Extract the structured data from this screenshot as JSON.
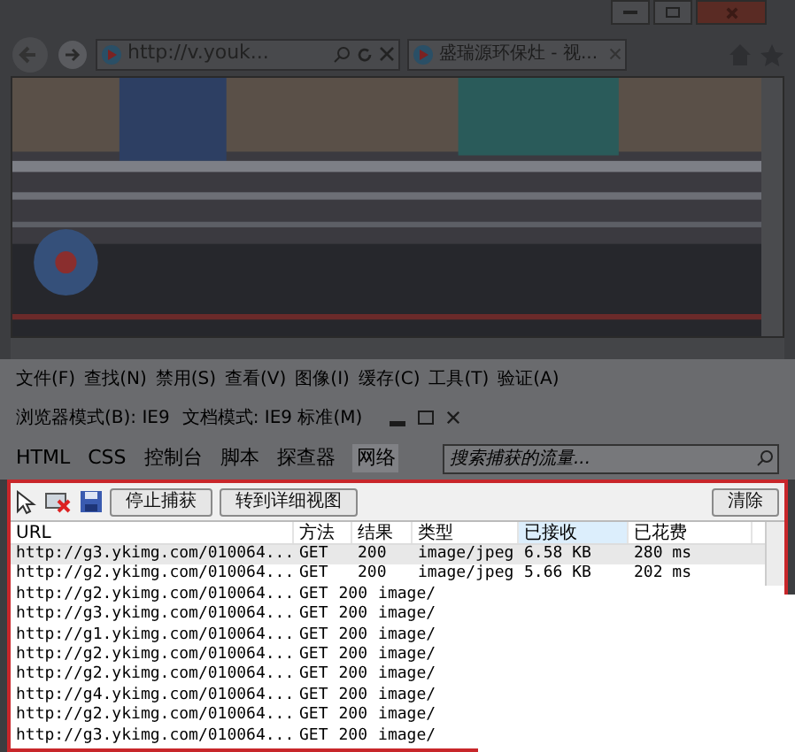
{
  "browser": {
    "address": "http://v.youk...",
    "tab_title": "盛瑞源环保灶 - 视..."
  },
  "devtools": {
    "menu": [
      "文件(F)",
      "查找(N)",
      "禁用(S)",
      "查看(V)",
      "图像(I)",
      "缓存(C)",
      "工具(T)",
      "验证(A)"
    ],
    "modes": [
      "浏览器模式(B): IE9",
      "文档模式: IE9 标准(M)"
    ],
    "tabs": [
      {
        "label": "HTML",
        "selected": false
      },
      {
        "label": "CSS",
        "selected": false
      },
      {
        "label": "控制台",
        "selected": false
      },
      {
        "label": "脚本",
        "selected": false
      },
      {
        "label": "探查器",
        "selected": false
      },
      {
        "label": "网络",
        "selected": true
      }
    ],
    "search": {
      "placeholder": "搜索捕获的流量..."
    },
    "buttons": [
      "停止捕获",
      "转到详细视图"
    ],
    "clear_button": "清除",
    "table": {
      "columns": [
        {
          "label": "URL",
          "sorted": false
        },
        {
          "label": "方法",
          "sorted": false
        },
        {
          "label": "结果",
          "sorted": false
        },
        {
          "label": "类型",
          "sorted": false
        },
        {
          "label": "已接收",
          "sorted": true
        },
        {
          "label": "已花费",
          "sorted": false
        }
      ],
      "rows": [
        {
          "url": "http://g3.ykimg.com/010064...",
          "method": "GET",
          "result": "200",
          "type": "image/jpeg",
          "received": "6.58 KB",
          "time": "280 ms",
          "selected": true
        },
        {
          "url": "http://g2.ykimg.com/010064...",
          "method": "GET",
          "result": "200",
          "type": "image/jpeg",
          "received": "5.66 KB",
          "time": "202 ms",
          "selected": false
        },
        {
          "url": "http://g2.ykimg.com/010064...",
          "method": "GET",
          "result": "200",
          "type": "image/",
          "selected": false
        },
        {
          "url": "http://g3.ykimg.com/010064...",
          "method": "GET",
          "result": "200",
          "type": "image/",
          "selected": false
        },
        {
          "url": "http://g1.ykimg.com/010064...",
          "method": "GET",
          "result": "200",
          "type": "image/",
          "selected": false
        },
        {
          "url": "http://g2.ykimg.com/010064...",
          "method": "GET",
          "result": "200",
          "type": "image/",
          "selected": false
        },
        {
          "url": "http://g2.ykimg.com/010064...",
          "method": "GET",
          "result": "200",
          "type": "image/",
          "selected": false
        },
        {
          "url": "http://g4.ykimg.com/010064...",
          "method": "GET",
          "result": "200",
          "type": "image/",
          "selected": false
        },
        {
          "url": "http://g2.ykimg.com/010064...",
          "method": "GET",
          "result": "200",
          "type": "image/",
          "selected": false
        },
        {
          "url": "http://g3.ykimg.com/010064...",
          "method": "GET",
          "result": "200",
          "type": "image/",
          "selected": false
        }
      ]
    }
  }
}
